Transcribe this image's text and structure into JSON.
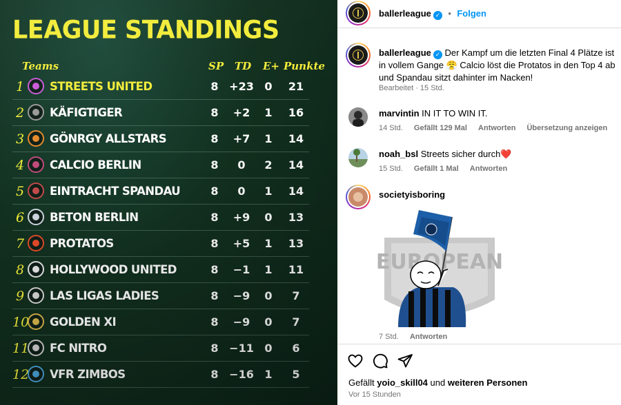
{
  "standings": {
    "title": "LEAGUE STANDINGS",
    "headers": {
      "teams": "Teams",
      "sp": "SP",
      "td": "TD",
      "e": "E+",
      "points": "Punkte"
    },
    "accent_color": "#f2ec3a",
    "rows": [
      {
        "rank": "1",
        "team": "STREETS UNITED",
        "sp": "8",
        "td": "+23",
        "e": "0",
        "pts": "21"
      },
      {
        "rank": "2",
        "team": "KÄFIGTIGER",
        "sp": "8",
        "td": "+2",
        "e": "1",
        "pts": "16"
      },
      {
        "rank": "3",
        "team": "GÖNRGY ALLSTARS",
        "sp": "8",
        "td": "+7",
        "e": "1",
        "pts": "14"
      },
      {
        "rank": "4",
        "team": "CALCIO BERLIN",
        "sp": "8",
        "td": "0",
        "e": "2",
        "pts": "14"
      },
      {
        "rank": "5",
        "team": "EINTRACHT SPANDAU",
        "sp": "8",
        "td": "0",
        "e": "1",
        "pts": "14"
      },
      {
        "rank": "6",
        "team": "BETON BERLIN",
        "sp": "8",
        "td": "+9",
        "e": "0",
        "pts": "13"
      },
      {
        "rank": "7",
        "team": "PROTATOS",
        "sp": "8",
        "td": "+5",
        "e": "1",
        "pts": "13"
      },
      {
        "rank": "8",
        "team": "HOLLYWOOD UNITED",
        "sp": "8",
        "td": "−1",
        "e": "1",
        "pts": "11"
      },
      {
        "rank": "9",
        "team": "LAS LIGAS LADIES",
        "sp": "8",
        "td": "−9",
        "e": "0",
        "pts": "7"
      },
      {
        "rank": "10",
        "team": "GOLDEN XI",
        "sp": "8",
        "td": "−9",
        "e": "0",
        "pts": "7"
      },
      {
        "rank": "11",
        "team": "FC NITRO",
        "sp": "8",
        "td": "−11",
        "e": "0",
        "pts": "6"
      },
      {
        "rank": "12",
        "team": "VFR ZIMBOS",
        "sp": "8",
        "td": "−16",
        "e": "1",
        "pts": "5"
      }
    ]
  },
  "post": {
    "author": "ballerleague",
    "dot": "•",
    "follow_label": "Folgen",
    "caption_author": "ballerleague",
    "caption_text": "Der Kampf um die letzten Final 4 Plätze ist in vollem Gange 😤 Calcio löst die Protatos in den Top 4 ab und Spandau sitzt dahinter im Nacken!",
    "caption_meta": "Bearbeitet · 15 Std.",
    "brand_color": "#0095f6"
  },
  "comments": [
    {
      "user": "marvintin",
      "text": "IN IT TO WIN IT.",
      "time": "14 Std.",
      "likes": "Gefällt 129 Mal",
      "reply": "Antworten",
      "translate": "Übersetzung anzeigen"
    },
    {
      "user": "noah_bsl",
      "text": "Streets sicher durch❤️",
      "time": "15 Std.",
      "likes": "Gefällt 1 Mal",
      "reply": "Antworten"
    },
    {
      "user": "societyisboring",
      "text": "",
      "time": "7 Std.",
      "reply": "Antworten",
      "sticker_text": "EUROPEAN"
    }
  ],
  "footer": {
    "liked_prefix": "Gefällt",
    "liked_user": "yoio_skill04",
    "liked_mid": "und",
    "liked_others": "weiteren Personen",
    "time_ago": "Vor 15 Stunden"
  }
}
